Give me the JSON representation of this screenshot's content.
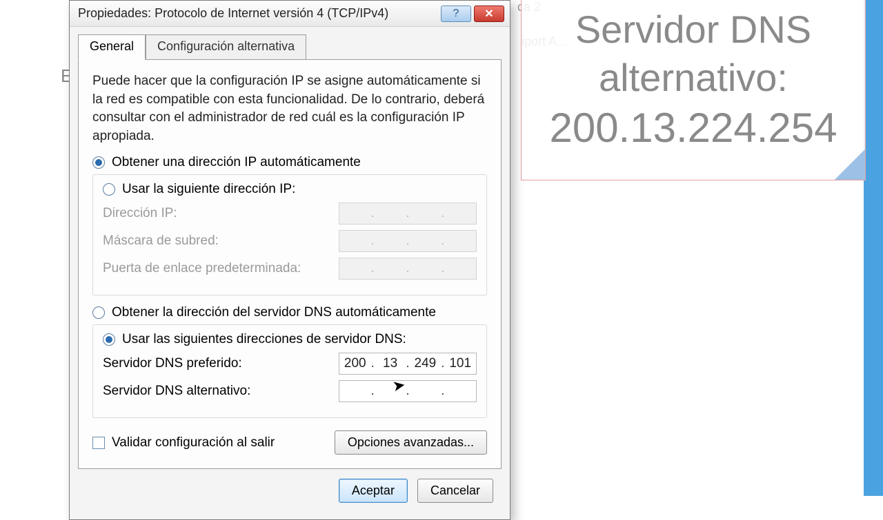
{
  "background": {
    "frag1": "ca 2",
    "frag2": "iport A...",
    "letter": "E"
  },
  "note": {
    "line1": "Servidor DNS",
    "line2": "alternativo:",
    "ip": "200.13.224.254"
  },
  "dialog": {
    "title": "Propiedades: Protocolo de Internet versión 4 (TCP/IPv4)",
    "help_icon": "?",
    "close_icon": "✕",
    "tabs": {
      "general": "General",
      "alt": "Configuración alternativa"
    },
    "description": "Puede hacer que la configuración IP se asigne automáticamente si la red es compatible con esta funcionalidad. De lo contrario, deberá consultar con el administrador de red cuál es la configuración IP apropiada.",
    "ip": {
      "auto_label": "Obtener una dirección IP automáticamente",
      "manual_label": "Usar la siguiente dirección IP:",
      "addr_label": "Dirección IP:",
      "mask_label": "Máscara de subred:",
      "gw_label": "Puerta de enlace predeterminada:"
    },
    "dns": {
      "auto_label": "Obtener la dirección del servidor DNS automáticamente",
      "manual_label": "Usar las siguientes direcciones de servidor DNS:",
      "pref_label": "Servidor DNS preferido:",
      "alt_label": "Servidor DNS alternativo:",
      "pref_value": {
        "a": "200",
        "b": "13",
        "c": "249",
        "d": "101"
      }
    },
    "validate_label": "Validar configuración al salir",
    "advanced_label": "Opciones avanzadas...",
    "ok_label": "Aceptar",
    "cancel_label": "Cancelar"
  }
}
